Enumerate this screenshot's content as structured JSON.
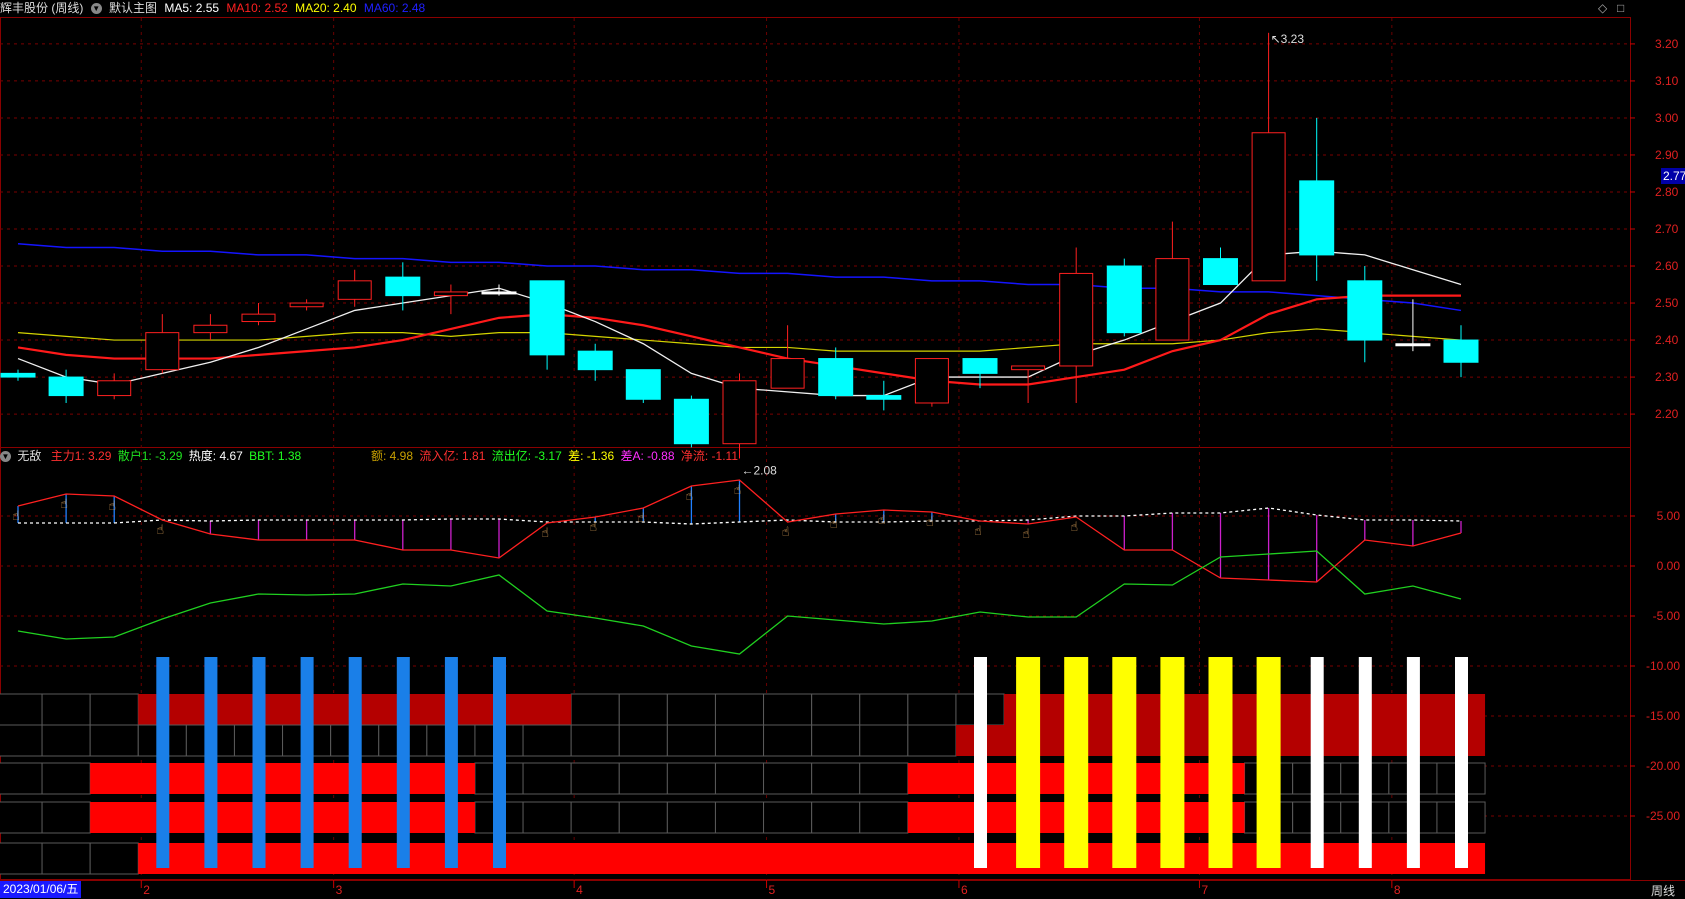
{
  "header": {
    "stock_name": "辉丰股份 (周线)",
    "template": "默认主图",
    "ma5": {
      "label": "MA5: 2.55",
      "color": "#ffffff"
    },
    "ma10": {
      "label": "MA10: 2.52",
      "color": "#ff2020"
    },
    "ma20": {
      "label": "MA20: 2.40",
      "color": "#ffff00"
    },
    "ma60": {
      "label": "MA60: 2.48",
      "color": "#1010ff"
    }
  },
  "indicator_header": {
    "name": "无敌",
    "items": [
      {
        "label": "主力1: 3.29",
        "color": "#ff3030"
      },
      {
        "label": "散户1: -3.29",
        "color": "#20e020"
      },
      {
        "label": "热度: 4.67",
        "color": "#ffffff"
      },
      {
        "label": "BBT: 1.38",
        "color": "#20ff20"
      }
    ],
    "items2": [
      {
        "label": "额: 4.98",
        "color": "#c8a000"
      },
      {
        "label": "流入亿: 1.81",
        "color": "#ff3030"
      },
      {
        "label": "流出亿: -3.17",
        "color": "#20ff20"
      },
      {
        "label": "差: -1.36",
        "color": "#ffff00"
      },
      {
        "label": "差A: -0.88",
        "color": "#ff30ff"
      },
      {
        "label": "净流: -1.11",
        "color": "#ff3030"
      }
    ]
  },
  "current_price": "2.77",
  "footer": {
    "date": "2023/01/06/五",
    "period": "周线"
  },
  "controls": {
    "diamond_icon": "◇",
    "maximize_icon": "□"
  },
  "price_axis": {
    "min": 2.1,
    "max": 3.25,
    "ticks": [
      "3.20",
      "3.10",
      "3.00",
      "2.90",
      "2.80",
      "2.70",
      "2.60",
      "2.50",
      "2.40",
      "2.30",
      "2.20"
    ]
  },
  "indicator_axis": {
    "ticks": [
      "5.00",
      "0.00",
      "-5.00",
      "-10.00",
      "-15.00",
      "-20.00",
      "-25.00"
    ]
  },
  "x_axis": {
    "months": [
      {
        "label": "2",
        "index": 3
      },
      {
        "label": "3",
        "index": 7
      },
      {
        "label": "4",
        "index": 12
      },
      {
        "label": "5",
        "index": 16
      },
      {
        "label": "6",
        "index": 20
      },
      {
        "label": "7",
        "index": 25
      },
      {
        "label": "8",
        "index": 29
      }
    ]
  },
  "annotations": {
    "high": "3.23",
    "low": "2.08"
  },
  "chart_data": {
    "type": "candlestick",
    "candles": [
      {
        "o": 2.31,
        "h": 2.32,
        "l": 2.29,
        "c": 2.3
      },
      {
        "o": 2.3,
        "h": 2.32,
        "l": 2.23,
        "c": 2.25
      },
      {
        "o": 2.25,
        "h": 2.31,
        "l": 2.24,
        "c": 2.29
      },
      {
        "o": 2.32,
        "h": 2.47,
        "l": 2.31,
        "c": 2.42
      },
      {
        "o": 2.42,
        "h": 2.47,
        "l": 2.4,
        "c": 2.44
      },
      {
        "o": 2.45,
        "h": 2.5,
        "l": 2.44,
        "c": 2.47
      },
      {
        "o": 2.49,
        "h": 2.51,
        "l": 2.48,
        "c": 2.5
      },
      {
        "o": 2.51,
        "h": 2.59,
        "l": 2.49,
        "c": 2.56
      },
      {
        "o": 2.57,
        "h": 2.61,
        "l": 2.48,
        "c": 2.52
      },
      {
        "o": 2.52,
        "h": 2.55,
        "l": 2.47,
        "c": 2.53
      },
      {
        "o": 2.53,
        "h": 2.55,
        "l": 2.52,
        "c": 2.53
      },
      {
        "o": 2.56,
        "h": 2.56,
        "l": 2.32,
        "c": 2.36
      },
      {
        "o": 2.37,
        "h": 2.39,
        "l": 2.29,
        "c": 2.32
      },
      {
        "o": 2.32,
        "h": 2.32,
        "l": 2.23,
        "c": 2.24
      },
      {
        "o": 2.24,
        "h": 2.25,
        "l": 2.11,
        "c": 2.12
      },
      {
        "o": 2.12,
        "h": 2.31,
        "l": 2.08,
        "c": 2.29
      },
      {
        "o": 2.27,
        "h": 2.44,
        "l": 2.27,
        "c": 2.35
      },
      {
        "o": 2.35,
        "h": 2.38,
        "l": 2.24,
        "c": 2.25
      },
      {
        "o": 2.25,
        "h": 2.29,
        "l": 2.21,
        "c": 2.24
      },
      {
        "o": 2.23,
        "h": 2.35,
        "l": 2.22,
        "c": 2.35
      },
      {
        "o": 2.35,
        "h": 2.35,
        "l": 2.27,
        "c": 2.31
      },
      {
        "o": 2.32,
        "h": 2.33,
        "l": 2.23,
        "c": 2.33
      },
      {
        "o": 2.33,
        "h": 2.65,
        "l": 2.23,
        "c": 2.58
      },
      {
        "o": 2.6,
        "h": 2.62,
        "l": 2.41,
        "c": 2.42
      },
      {
        "o": 2.4,
        "h": 2.72,
        "l": 2.4,
        "c": 2.62
      },
      {
        "o": 2.62,
        "h": 2.65,
        "l": 2.55,
        "c": 2.55
      },
      {
        "o": 2.56,
        "h": 3.23,
        "l": 2.56,
        "c": 2.96
      },
      {
        "o": 2.83,
        "h": 3.0,
        "l": 2.56,
        "c": 2.63
      },
      {
        "o": 2.56,
        "h": 2.6,
        "l": 2.34,
        "c": 2.4
      },
      {
        "o": 2.39,
        "h": 2.51,
        "l": 2.37,
        "c": 2.39
      },
      {
        "o": 2.4,
        "h": 2.44,
        "l": 2.3,
        "c": 2.34
      }
    ],
    "ma5": [
      2.35,
      2.3,
      2.28,
      2.31,
      2.34,
      2.38,
      2.43,
      2.48,
      2.5,
      2.52,
      2.54,
      2.5,
      2.45,
      2.39,
      2.31,
      2.27,
      2.26,
      2.25,
      2.25,
      2.3,
      2.3,
      2.3,
      2.36,
      2.4,
      2.45,
      2.5,
      2.63,
      2.64,
      2.63,
      2.59,
      2.55
    ],
    "ma10": [
      2.38,
      2.36,
      2.35,
      2.35,
      2.35,
      2.36,
      2.37,
      2.38,
      2.4,
      2.43,
      2.46,
      2.47,
      2.46,
      2.44,
      2.41,
      2.38,
      2.35,
      2.33,
      2.31,
      2.29,
      2.28,
      2.28,
      2.3,
      2.32,
      2.37,
      2.4,
      2.47,
      2.51,
      2.52,
      2.52,
      2.52
    ],
    "ma20": [
      2.42,
      2.41,
      2.4,
      2.4,
      2.4,
      2.4,
      2.41,
      2.42,
      2.42,
      2.41,
      2.42,
      2.42,
      2.41,
      2.4,
      2.39,
      2.38,
      2.38,
      2.37,
      2.37,
      2.37,
      2.37,
      2.38,
      2.39,
      2.39,
      2.39,
      2.4,
      2.42,
      2.43,
      2.42,
      2.41,
      2.4
    ],
    "ma60": [
      2.66,
      2.65,
      2.65,
      2.64,
      2.64,
      2.63,
      2.63,
      2.62,
      2.62,
      2.61,
      2.61,
      2.6,
      2.6,
      2.59,
      2.59,
      2.58,
      2.58,
      2.57,
      2.57,
      2.56,
      2.56,
      2.55,
      2.55,
      2.54,
      2.54,
      2.53,
      2.53,
      2.52,
      2.51,
      2.5,
      2.48
    ],
    "indicator": {
      "ylim": [
        -31,
        10
      ],
      "main_line": [
        6.0,
        7.2,
        7.0,
        4.6,
        3.2,
        2.6,
        2.6,
        2.6,
        1.6,
        1.6,
        0.8,
        4.3,
        4.9,
        5.8,
        8.0,
        8.6,
        4.4,
        5.2,
        5.6,
        5.4,
        4.5,
        4.2,
        4.9,
        1.6,
        1.6,
        -1.2,
        -1.4,
        -1.6,
        2.6,
        2.0,
        3.3
      ],
      "white_dashed": [
        4.3,
        4.3,
        4.3,
        4.6,
        4.5,
        4.6,
        4.6,
        4.6,
        4.6,
        4.7,
        4.7,
        4.4,
        4.4,
        4.4,
        4.2,
        4.4,
        4.6,
        4.4,
        4.4,
        4.5,
        4.5,
        4.6,
        5.0,
        5.0,
        5.3,
        5.3,
        5.8,
        5.1,
        4.6,
        4.6,
        4.5
      ],
      "green_line": [
        -6.5,
        -7.3,
        -7.1,
        -5.3,
        -3.7,
        -2.8,
        -2.9,
        -2.8,
        -1.8,
        -2.0,
        -0.9,
        -4.5,
        -5.2,
        -6.0,
        -8.0,
        -8.8,
        -5.0,
        -5.4,
        -5.8,
        -5.5,
        -4.6,
        -5.1,
        -5.1,
        -1.8,
        -1.9,
        0.9,
        1.2,
        1.5,
        -2.8,
        -2.0,
        -3.3
      ],
      "hand_markers": [
        0,
        1,
        2,
        3,
        11,
        12,
        13,
        14,
        15,
        16,
        17,
        18,
        19,
        20,
        21,
        22
      ],
      "blue_bars": [
        3,
        4,
        5,
        6,
        7,
        8,
        9,
        10
      ],
      "white_bars": [
        20,
        25,
        26,
        27,
        28,
        29,
        30
      ],
      "yellow_bars": [
        21,
        22,
        23,
        24,
        25,
        26
      ],
      "heat_rows": [
        {
          "red_from": 3,
          "red_to": 12,
          "red2_from": 21,
          "red2_to": 31,
          "dark": true
        },
        {
          "red_from": 20,
          "red_to": 31,
          "dark": true
        },
        {
          "red_from": 2,
          "red_to": 10,
          "red2_from": 19,
          "red2_to": 26
        },
        {
          "red_from": 2,
          "red_to": 10,
          "red2_from": 19,
          "red2_to": 26
        },
        {
          "red_from": 3,
          "red_to": 31
        }
      ]
    }
  }
}
